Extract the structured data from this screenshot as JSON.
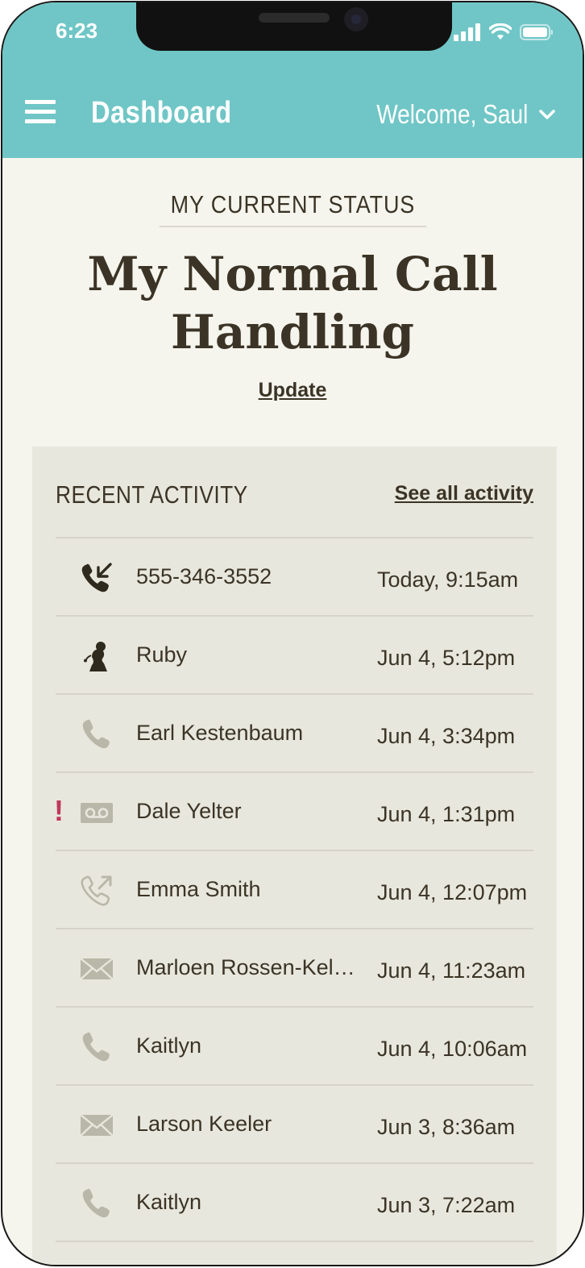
{
  "status_bar": {
    "time": "6:23"
  },
  "header": {
    "title": "Dashboard",
    "welcome": "Welcome, Saul"
  },
  "current_status": {
    "label": "MY CURRENT STATUS",
    "value": "My Normal Call Handling",
    "update_label": "Update"
  },
  "recent_activity": {
    "title": "RECENT ACTIVITY",
    "see_all_label": "See all activity",
    "items": [
      {
        "icon": "incoming-call-icon",
        "name": "555-346-3552",
        "time": "Today, 9:15am",
        "alert": ""
      },
      {
        "icon": "receptionist-icon",
        "name": "Ruby",
        "time": "Jun 4, 5:12pm",
        "alert": ""
      },
      {
        "icon": "phone-icon",
        "name": "Earl Kestenbaum",
        "time": "Jun 4, 3:34pm",
        "alert": ""
      },
      {
        "icon": "voicemail-icon",
        "name": "Dale Yelter",
        "time": "Jun 4, 1:31pm",
        "alert": "!"
      },
      {
        "icon": "outgoing-call-icon",
        "name": "Emma Smith",
        "time": "Jun 4, 12:07pm",
        "alert": ""
      },
      {
        "icon": "mail-icon",
        "name": "Marloen Rossen-Kellerman",
        "time": "Jun 4, 11:23am",
        "alert": ""
      },
      {
        "icon": "phone-icon",
        "name": "Kaitlyn",
        "time": "Jun 4, 10:06am",
        "alert": ""
      },
      {
        "icon": "mail-icon",
        "name": "Larson Keeler",
        "time": "Jun 3, 8:36am",
        "alert": ""
      },
      {
        "icon": "phone-icon",
        "name": "Kaitlyn",
        "time": "Jun 3, 7:22am",
        "alert": ""
      }
    ]
  },
  "colors": {
    "header": "#70c6c6",
    "background": "#f5f5ee",
    "panel": "#e8e7dd",
    "text": "#3b3426",
    "alert": "#c0395a",
    "icon_dark": "#2f2a1e",
    "icon_light": "#b9b7a8"
  }
}
